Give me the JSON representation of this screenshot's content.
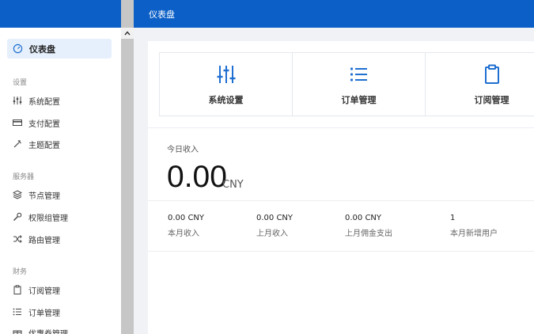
{
  "header": {
    "title": "仪表盘"
  },
  "sidebar": {
    "dashboard_label": "仪表盘",
    "sections": [
      {
        "title": "设置",
        "items": [
          {
            "label": "系统配置",
            "icon": "sliders-icon"
          },
          {
            "label": "支付配置",
            "icon": "credit-card-icon"
          },
          {
            "label": "主题配置",
            "icon": "brush-icon"
          }
        ]
      },
      {
        "title": "服务器",
        "items": [
          {
            "label": "节点管理",
            "icon": "layers-icon"
          },
          {
            "label": "权限组管理",
            "icon": "wrench-icon"
          },
          {
            "label": "路由管理",
            "icon": "shuffle-icon"
          }
        ]
      },
      {
        "title": "财务",
        "items": [
          {
            "label": "订阅管理",
            "icon": "clipboard-icon"
          },
          {
            "label": "订单管理",
            "icon": "list-icon"
          },
          {
            "label": "优惠券管理",
            "icon": "gift-icon"
          }
        ]
      }
    ]
  },
  "shortcuts": [
    {
      "label": "系统设置",
      "icon": "sliders-icon"
    },
    {
      "label": "订单管理",
      "icon": "list-icon"
    },
    {
      "label": "订阅管理",
      "icon": "clipboard-icon"
    }
  ],
  "income": {
    "label": "今日收入",
    "value": "0.00",
    "unit": "CNY"
  },
  "stats": [
    {
      "value": "0.00 CNY",
      "label": "本月收入"
    },
    {
      "value": "0.00 CNY",
      "label": "上月收入"
    },
    {
      "value": "0.00 CNY",
      "label": "上月佣金支出"
    },
    {
      "value": "1",
      "label": "本月新增用户"
    }
  ],
  "colors": {
    "primary": "#0b5fc6",
    "icon_blue": "#1f6fd1"
  }
}
